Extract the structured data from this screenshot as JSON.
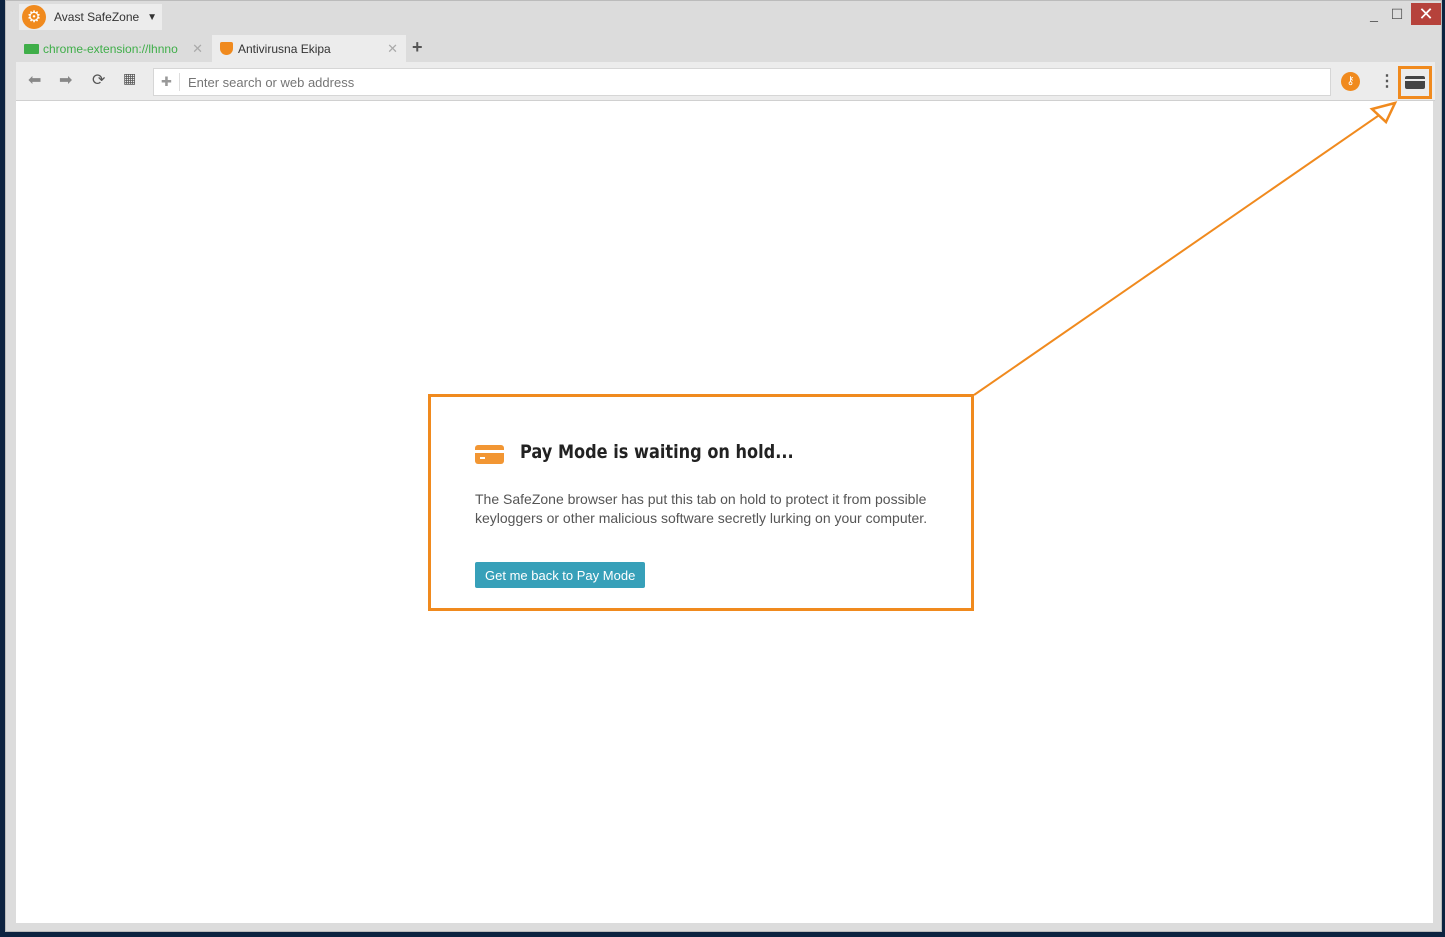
{
  "app": {
    "title": "Avast SafeZone",
    "logo_icon": "avast-gear-icon"
  },
  "window_controls": {
    "minimize": "_",
    "maximize": "☐",
    "close": "✕"
  },
  "tabs": [
    {
      "label": "chrome-extension://lhnno",
      "icon": "card-icon",
      "active": false
    },
    {
      "label": "Antivirusna Ekipa",
      "icon": "avast-shield-icon",
      "active": true
    }
  ],
  "toolbar": {
    "address_placeholder": "Enter search or web address",
    "address_value": ""
  },
  "hold_page": {
    "title": "Pay Mode is waiting on hold...",
    "description": "The SafeZone browser has put this tab on hold to protect it from possible keyloggers or other malicious software secretly lurking on your computer.",
    "button": "Get me back to Pay Mode"
  },
  "colors": {
    "accent": "#f08a1e",
    "button": "#37a0b9",
    "close": "#b6423b"
  }
}
